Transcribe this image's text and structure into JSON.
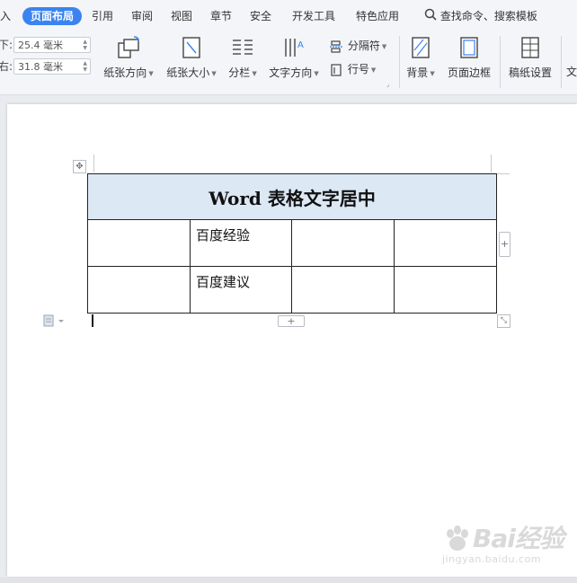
{
  "menu": {
    "tabs": [
      "入",
      "页面布局",
      "引用",
      "审阅",
      "视图",
      "章节",
      "安全",
      "开发工具",
      "特色应用"
    ],
    "active_tab": "页面布局",
    "search_label": "查找命令、搜索模板"
  },
  "margins": {
    "bottom_label": "下:",
    "bottom_value": "25.4 毫米",
    "right_label": "右:",
    "right_value": "31.8 毫米"
  },
  "toolbar": {
    "orientation": "纸张方向",
    "size": "纸张大小",
    "columns": "分栏",
    "text_direction": "文字方向",
    "breaks": "分隔符",
    "line_numbers": "行号",
    "background": "背景",
    "page_border": "页面边框",
    "manuscript": "稿纸设置",
    "more": "文"
  },
  "table": {
    "header": "Word 表格文字居中",
    "rows": [
      [
        "",
        "百度经验",
        "",
        ""
      ],
      [
        "",
        "百度建议",
        "",
        ""
      ]
    ]
  },
  "watermark": {
    "brand": "Bai经验",
    "url": "jingyan.baidu.com"
  },
  "colors": {
    "accent": "#3a83f0",
    "header_fill": "#dde8f5"
  }
}
